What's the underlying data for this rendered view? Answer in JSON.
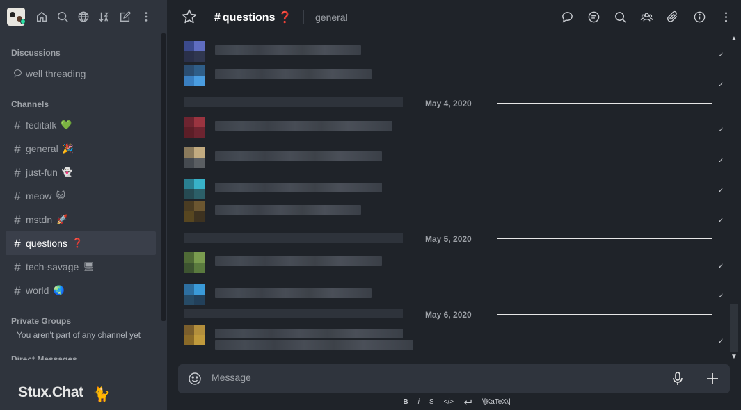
{
  "sidebar": {
    "sections": {
      "discussions": "Discussions",
      "channels": "Channels",
      "private_groups": "Private Groups",
      "direct_messages": "Direct Messages"
    },
    "discussion_items": [
      {
        "label": "well threading",
        "icon": "discussion-icon"
      }
    ],
    "channels": [
      {
        "label": "feditalk",
        "emoji": "💚",
        "emoji_color": "#37c837"
      },
      {
        "label": "general",
        "emoji": "🎉",
        "emoji_color": "#e6b800"
      },
      {
        "label": "just-fun",
        "emoji": "👻",
        "emoji_color": "#ffffff"
      },
      {
        "label": "meow",
        "emoji": "😺",
        "emoji_color": "#f2b53a"
      },
      {
        "label": "mstdn",
        "emoji": "🚀",
        "emoji_color": "#cfd3d8"
      },
      {
        "label": "questions",
        "emoji": "❓",
        "emoji_color": "#e0292c",
        "active": true
      },
      {
        "label": "tech-savage",
        "emoji": "🖥",
        "emoji_color": "#cfd3d8"
      },
      {
        "label": "world",
        "emoji": "🌏",
        "emoji_color": "#2f8fd8"
      }
    ],
    "private_groups_note": "You aren't part of any channel yet",
    "brand": "Stux.Chat",
    "brand_cat": "🐈"
  },
  "header": {
    "title": "questions",
    "title_emoji": "❓",
    "topic": "general"
  },
  "days": [
    "May 4, 2020",
    "May 5, 2020",
    "May 6, 2020"
  ],
  "composer": {
    "placeholder": "Message"
  },
  "format_bar": {
    "bold": "B",
    "italic": "i",
    "strike": "S",
    "code": "</>",
    "katex": "\\[KaTeX\\]"
  },
  "check_mark": "✓",
  "colors": {
    "sidebar_bg": "#2f343d",
    "main_bg": "#1f2329",
    "active_item": "#3a3f4a",
    "status_online": "#2de0a5"
  }
}
